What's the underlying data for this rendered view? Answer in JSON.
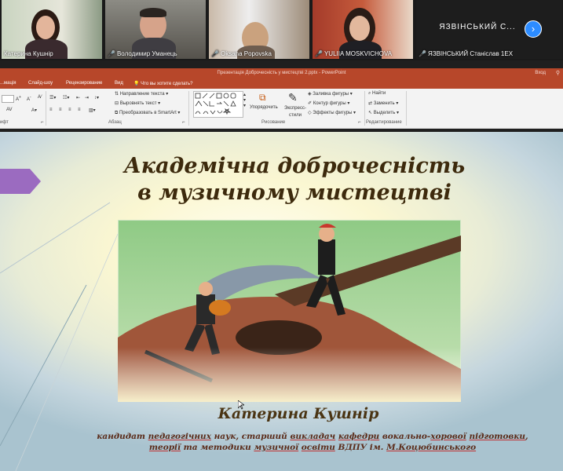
{
  "participants": [
    {
      "name": "Катерина Кушнір",
      "muted": false,
      "active": true
    },
    {
      "name": "Володимир Уманець",
      "muted": true,
      "active": false
    },
    {
      "name": "Oksana Popovska",
      "muted": true,
      "active": false
    },
    {
      "name": "YULIIA MOSKVICHOVA",
      "muted": true,
      "active": false
    },
    {
      "name": "ЯЗВІНСЬКИЙ Станіслав 1ЕХ",
      "muted": true,
      "active": false,
      "display_label": "ЯЗВІНСЬКИЙ С..."
    }
  ],
  "window": {
    "title": "Презентація Доброчесність у мистецтві 2.pptx  -  PowerPoint",
    "login": "Вход"
  },
  "menu": [
    "...мація",
    "Слайд-шоу",
    "Рецензирование",
    "Вид",
    "Что вы хотите сделать?"
  ],
  "ribbon": {
    "text_direction": "Направление текста",
    "align_text": "Выровнять текст",
    "convert_smartart": "Преобразовать в SmartArt",
    "paragraph_group": "Абзац",
    "arrange": "Упорядочить",
    "quick_styles": "Экспресс-стили",
    "shape_fill": "Заливка фигуры",
    "shape_outline": "Контур фигуры",
    "shape_effects": "Эффекты фигуры",
    "drawing_group": "Рисование",
    "find": "Найти",
    "replace": "Заменить",
    "select": "Выделить",
    "editing_group": "Редактирование",
    "font_group": "Шрифт"
  },
  "slide": {
    "title_line1": "Академічна  доброчесність",
    "title_line2": "в музичному мистецтві",
    "author": "Катерина Кушнір",
    "desc_line1_parts": [
      "кандидат ",
      "педагогічних",
      " наук, старший ",
      "викладач",
      " ",
      "кафедри",
      " вокально-",
      "хорової",
      " ",
      "підготовки",
      ","
    ],
    "desc_line2_parts": [
      "теорії",
      " та методики ",
      "музичної",
      " ",
      "освіти",
      " ВДПУ ім. ",
      "М.Коцюбинського"
    ]
  },
  "colors": {
    "ppt_accent": "#b7472a",
    "active_speaker": "#7bd22a",
    "zoom_blue": "#2d8cff",
    "title_text": "#3d2a0d",
    "arrow_purple": "#9b6bc0"
  }
}
